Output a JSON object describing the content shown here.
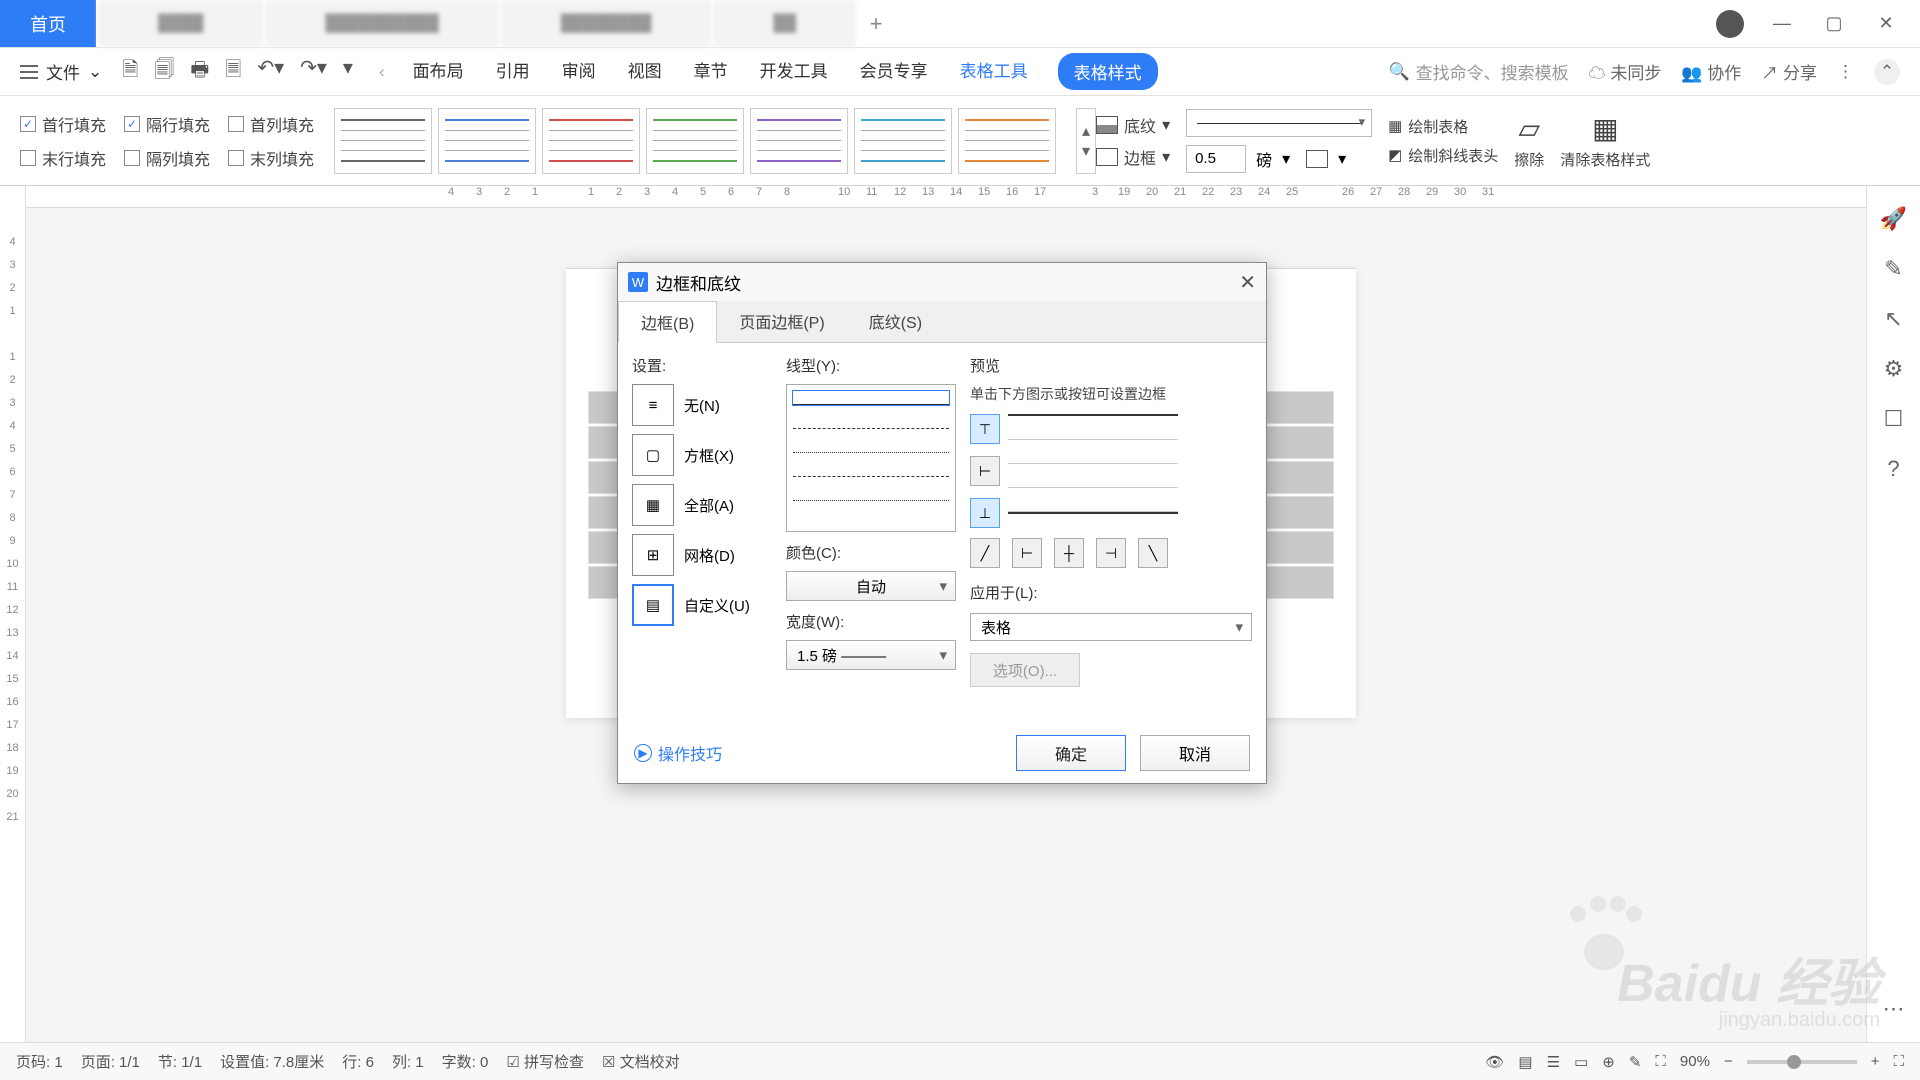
{
  "titlebar": {
    "home_tab": "首页"
  },
  "menubar": {
    "file": "文件",
    "tabs": [
      "面布局",
      "引用",
      "审阅",
      "视图",
      "章节",
      "开发工具",
      "会员专享"
    ],
    "context_tab": "表格工具",
    "active_tab": "表格样式",
    "search_placeholder": "查找命令、搜索模板",
    "unsync": "未同步",
    "collab": "协作",
    "share": "分享"
  },
  "ribbon": {
    "checks": {
      "first_row": "首行填充",
      "alt_row": "隔行填充",
      "first_col": "首列填充",
      "last_row": "末行填充",
      "alt_col": "隔列填充",
      "last_col": "末列填充"
    },
    "style_colors": [
      "#666",
      "#4a7dd8",
      "#d05050",
      "#5aa850",
      "#8a62c8",
      "#3fa0c8",
      "#e08a3a"
    ],
    "shading": "底纹",
    "border": "边框",
    "weight_value": "0.5",
    "weight_unit": "磅",
    "draw_table": "绘制表格",
    "draw_diag": "绘制斜线表头",
    "erase": "擦除",
    "clear_style": "清除表格样式"
  },
  "hruler": [
    "4",
    "3",
    "2",
    "1",
    "",
    "1",
    "2",
    "3",
    "4",
    "5",
    "6",
    "7",
    "8",
    "",
    "10",
    "11",
    "12",
    "13",
    "14",
    "15",
    "16",
    "17",
    "",
    "3",
    "19",
    "20",
    "21",
    "22",
    "23",
    "24",
    "25",
    "",
    "26",
    "27",
    "28",
    "29",
    "30",
    "31"
  ],
  "vruler": [
    "4",
    "3",
    "2",
    "1",
    "",
    "1",
    "2",
    "3",
    "4",
    "5",
    "6",
    "7",
    "8",
    "9",
    "10",
    "11",
    "12",
    "13",
    "14",
    "15",
    "16",
    "17",
    "18",
    "19",
    "20",
    "21"
  ],
  "dialog": {
    "title": "边框和底纹",
    "tabs": {
      "border": "边框(B)",
      "page_border": "页面边框(P)",
      "shading": "底纹(S)"
    },
    "settings_label": "设置:",
    "presets": {
      "none": "无(N)",
      "box": "方框(X)",
      "all": "全部(A)",
      "grid": "网格(D)",
      "custom": "自定义(U)"
    },
    "linestyle_label": "线型(Y):",
    "color_label": "颜色(C):",
    "color_value": "自动",
    "width_label": "宽度(W):",
    "width_value": "1.5  磅 ———",
    "preview_label": "预览",
    "preview_hint": "单击下方图示或按钮可设置边框",
    "apply_label": "应用于(L):",
    "apply_value": "表格",
    "options": "选项(O)...",
    "tips": "操作技巧",
    "ok": "确定",
    "cancel": "取消"
  },
  "statusbar": {
    "page_no": "页码: 1",
    "page": "页面: 1/1",
    "section": "节: 1/1",
    "setting": "设置值: 7.8厘米",
    "row": "行: 6",
    "col": "列: 1",
    "chars": "字数: 0",
    "spell": "拼写检查",
    "proof": "文档校对",
    "zoom": "90%"
  },
  "watermark": {
    "brand": "Baidu 经验",
    "url": "jingyan.baidu.com"
  }
}
